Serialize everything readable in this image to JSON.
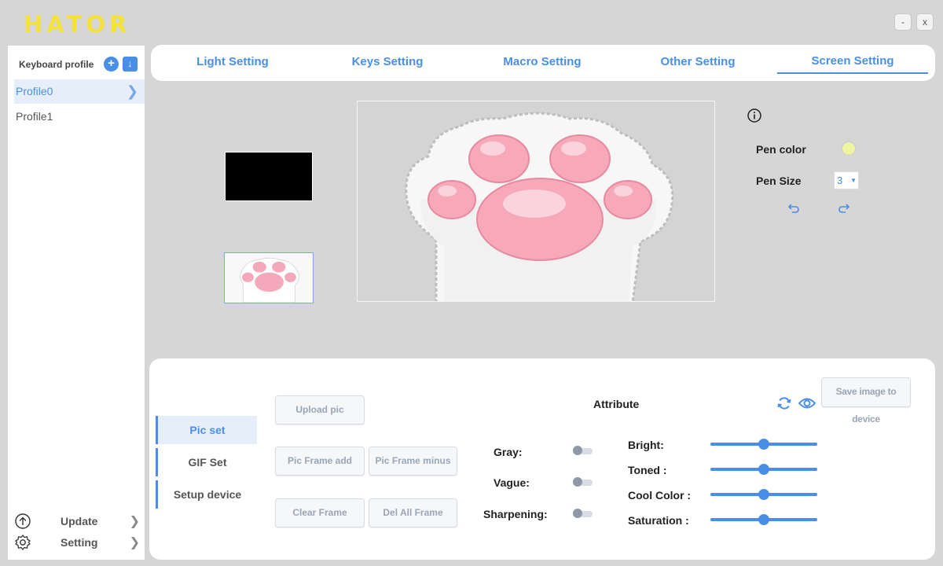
{
  "app": {
    "logo_text": "HATOR",
    "minimize_label": "-",
    "close_label": "x"
  },
  "sidebar": {
    "title": "Keyboard profile",
    "add_label": "+",
    "import_label": "↓",
    "profiles": [
      {
        "label": "Profile0",
        "selected": true
      },
      {
        "label": "Profile1",
        "selected": false
      }
    ],
    "bottom": [
      {
        "label": "Update",
        "icon": "arrow-up-circle-icon"
      },
      {
        "label": "Setting",
        "icon": "gear-icon"
      }
    ]
  },
  "tabs": {
    "items": [
      {
        "label": "Light Setting"
      },
      {
        "label": "Keys Setting"
      },
      {
        "label": "Macro Setting"
      },
      {
        "label": "Other Setting"
      },
      {
        "label": "Screen Setting"
      }
    ],
    "active": "Screen Setting"
  },
  "tools": {
    "info_icon": "info-icon",
    "pen_color_label": "Pen color",
    "pen_color": "#eef5a0",
    "pen_size_label": "Pen Size",
    "pen_size_value": "3",
    "undo_icon": "undo-icon",
    "redo_icon": "redo-icon"
  },
  "bottom_panel": {
    "subtabs": [
      {
        "label": "Pic set"
      },
      {
        "label": "GIF Set"
      },
      {
        "label": "Setup device"
      }
    ],
    "active_subtab": "Pic set",
    "buttons": {
      "upload": "Upload pic",
      "frame_add": "Pic Frame add",
      "frame_minus": "Pic Frame minus",
      "clear_frame": "Clear Frame",
      "del_all": "Del All Frame",
      "save_to_device": "Save image to device"
    },
    "attribute_title": "Attribute",
    "toggles": [
      {
        "label": "Gray:",
        "on": false
      },
      {
        "label": "Vague:",
        "on": false
      },
      {
        "label": "Sharpening:",
        "on": false
      }
    ],
    "sliders": [
      {
        "label": "Bright:",
        "value": 0.5
      },
      {
        "label": "Toned :",
        "value": 0.5
      },
      {
        "label": "Cool Color :",
        "value": 0.5
      },
      {
        "label": "Saturation :",
        "value": 0.5
      }
    ]
  },
  "colors": {
    "accent": "#4a8fe7",
    "logo": "#f4e23c",
    "background": "#d6d6d6",
    "paw_pad": "#f4a9bb"
  }
}
